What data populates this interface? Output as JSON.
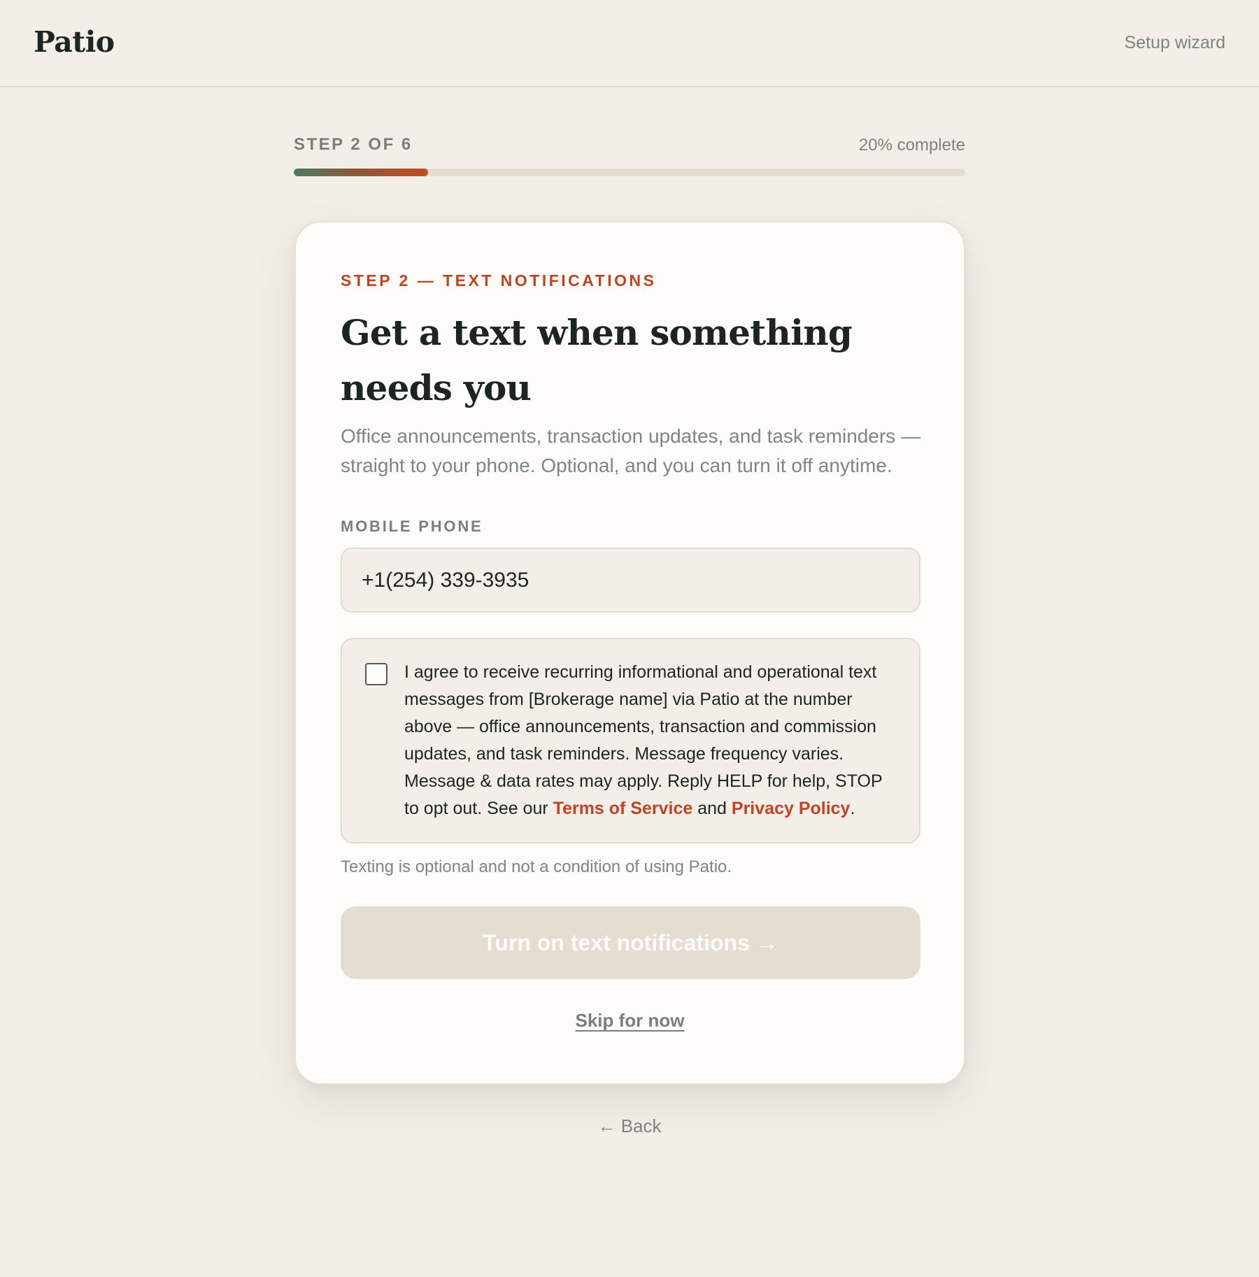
{
  "header": {
    "brand": "Patio",
    "wizard_link": "Setup wizard"
  },
  "progress": {
    "step_label": "STEP 2 OF 6",
    "percent_label": "20% complete",
    "fraction": 0.2
  },
  "card": {
    "eyebrow": "STEP 2 — TEXT NOTIFICATIONS",
    "headline": "Get a text when something needs you",
    "subtext": "Office announcements, transaction updates, and task reminders — straight to your phone. Optional, and you can turn it off anytime.",
    "phone": {
      "label": "MOBILE PHONE",
      "value": "+1(254) 339-3935"
    },
    "consent": {
      "checked": false,
      "text_before": "I agree to receive recurring informational and operational text messages from [Brokerage name] via Patio at the number above — office announcements, transaction and commission updates, and task reminders. Message frequency varies. Message & data rates may apply. Reply HELP for help, STOP to opt out. See our ",
      "terms_link": "Terms of Service",
      "text_between": " and ",
      "privacy_link": "Privacy Policy",
      "text_after": "."
    },
    "fine_print": "Texting is optional and not a condition of using Patio.",
    "submit_button": "Turn on text notifications →",
    "skip_link": "Skip for now"
  },
  "footer": {
    "back_link": "← Back"
  },
  "colors": {
    "page_background": "#f3efe8",
    "accent": "#c04322",
    "progress_start": "#4c7a60",
    "progress_end": "#c44a24",
    "disabled_button": "#e4ddd2"
  }
}
